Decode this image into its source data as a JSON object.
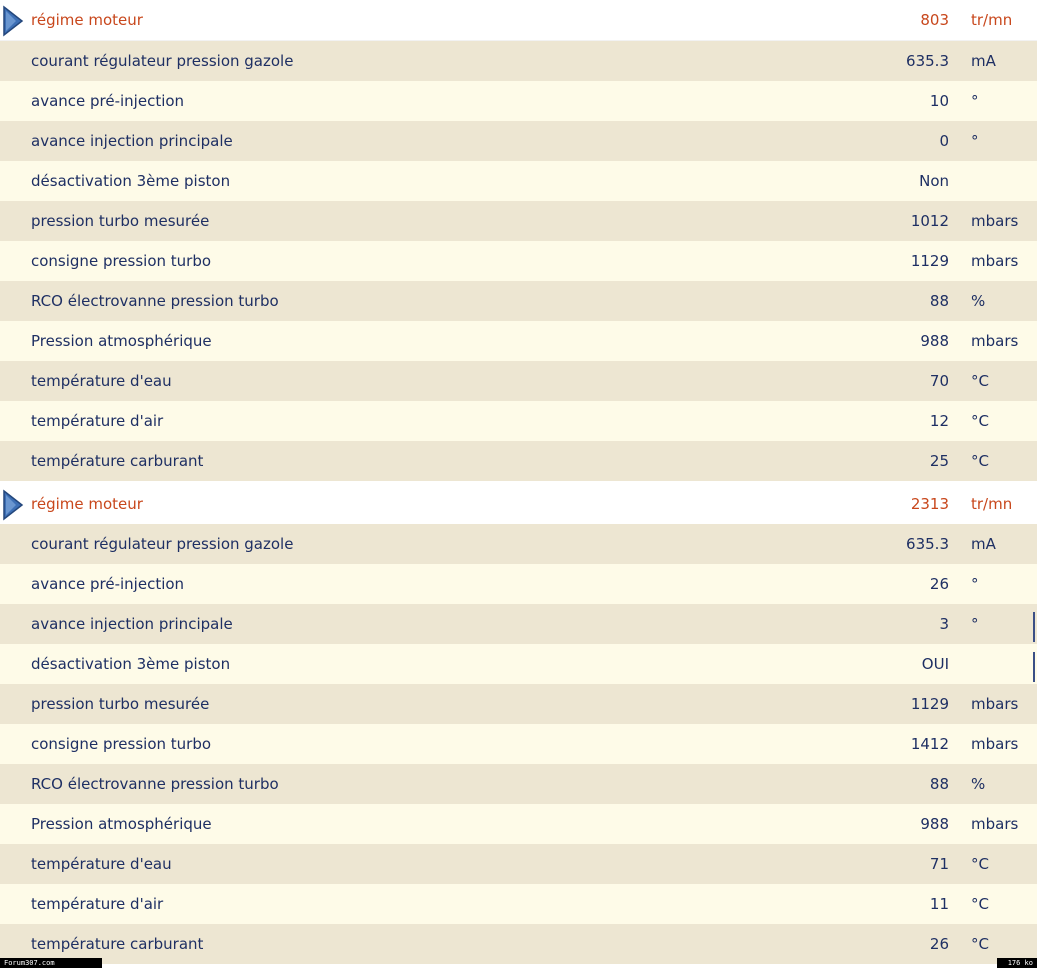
{
  "panels": [
    {
      "header": {
        "label": "régime moteur",
        "value": "803",
        "unit": "tr/mn"
      },
      "rows": [
        {
          "label": "courant régulateur pression gazole",
          "value": "635.3",
          "unit": "mA"
        },
        {
          "label": "avance pré-injection",
          "value": "10",
          "unit": "°"
        },
        {
          "label": "avance injection principale",
          "value": "0",
          "unit": "°"
        },
        {
          "label": "désactivation 3ème piston",
          "value": "Non",
          "unit": ""
        },
        {
          "label": "pression turbo mesurée",
          "value": "1012",
          "unit": "mbars"
        },
        {
          "label": "consigne pression turbo",
          "value": "1129",
          "unit": "mbars"
        },
        {
          "label": "RCO électrovanne pression turbo",
          "value": "88",
          "unit": "%"
        },
        {
          "label": "Pression atmosphérique",
          "value": "988",
          "unit": "mbars"
        },
        {
          "label": "température d'eau",
          "value": "70",
          "unit": "°C"
        },
        {
          "label": "température d'air",
          "value": "12",
          "unit": "°C"
        },
        {
          "label": "température carburant",
          "value": "25",
          "unit": "°C"
        }
      ]
    },
    {
      "header": {
        "label": "régime moteur",
        "value": "2313",
        "unit": "tr/mn"
      },
      "rows": [
        {
          "label": "courant régulateur pression gazole",
          "value": "635.3",
          "unit": "mA"
        },
        {
          "label": "avance pré-injection",
          "value": "26",
          "unit": "°"
        },
        {
          "label": "avance injection principale",
          "value": "3",
          "unit": "°"
        },
        {
          "label": "désactivation 3ème piston",
          "value": "OUI",
          "unit": ""
        },
        {
          "label": "pression turbo mesurée",
          "value": "1129",
          "unit": "mbars"
        },
        {
          "label": "consigne pression turbo",
          "value": "1412",
          "unit": "mbars"
        },
        {
          "label": "RCO électrovanne pression turbo",
          "value": "88",
          "unit": "%"
        },
        {
          "label": "Pression atmosphérique",
          "value": "988",
          "unit": "mbars"
        },
        {
          "label": "température d'eau",
          "value": "71",
          "unit": "°C"
        },
        {
          "label": "température d'air",
          "value": "11",
          "unit": "°C"
        },
        {
          "label": "température carburant",
          "value": "26",
          "unit": "°C"
        }
      ]
    }
  ],
  "footer": {
    "left_text": "Forum307.com",
    "right_text": "176 ko"
  },
  "colors": {
    "header_text": "#c8471c",
    "row_text": "#1e2f63",
    "row_alt_a": "#ede6d2",
    "row_alt_b": "#fefbe8",
    "arrow_fill": "#3d6fb5"
  },
  "icons": {
    "header_arrow": "triangle-right-icon"
  }
}
